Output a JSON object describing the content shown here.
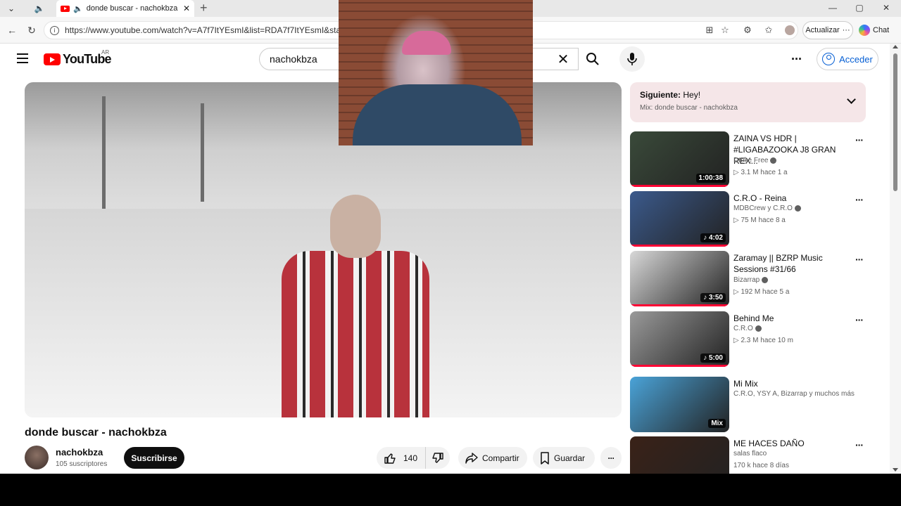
{
  "browser": {
    "tab_title": "donde buscar - nachokbza - Y",
    "url": "https://www.youtube.com/watch?v=A7f7ItYEsmI&list=RDA7f7ItYEsmI&start_",
    "update_label": "Actualizar",
    "chat_label": "Chat"
  },
  "youtube": {
    "logo_text": "YouTube",
    "country_code": "AR",
    "search_value": "nachokbza",
    "signin_label": "Acceder"
  },
  "video": {
    "title": "donde buscar - nachokbza",
    "channel": "nachokbza",
    "subscribers": "105 suscriptores",
    "subscribe_label": "Suscribirse",
    "likes": "140",
    "share_label": "Compartir",
    "save_label": "Guardar"
  },
  "up_next": {
    "label": "Siguiente:",
    "title": "Hey!",
    "playlist": "Mix: donde buscar - nachokbza"
  },
  "related": [
    {
      "title": "ZAINA VS HDR | #LIGABAZOOKA J8 GRAN REX...",
      "channel": "Dtoke Free",
      "meta": "▷ 3.1 M   hace 1 a",
      "duration": "1:00:38",
      "color": "#3a4a3a"
    },
    {
      "title": "C.R.O - Reina",
      "channel": "MDBCrew  y C.R.O",
      "meta": "▷ 75 M   hace 8 a",
      "duration": "♪ 4:02",
      "color": "#3b5a8c"
    },
    {
      "title": "Zaramay || BZRP Music Sessions #31/66",
      "channel": "Bizarrap",
      "meta": "▷ 192 M   hace 5 a",
      "duration": "♪ 3:50",
      "color": "#d8d8d8"
    },
    {
      "title": "Behind Me",
      "channel": "C.R.O",
      "meta": "▷ 2.3 M   hace 10 m",
      "duration": "♪ 5:00",
      "color": "#9a9a9a"
    },
    {
      "title": "Mi Mix",
      "channel": "C.R.O, YSY A, Bizarrap y muchos más",
      "meta": "",
      "duration": "Mix",
      "color": "#4aa3d8"
    },
    {
      "title": "ME HACES DAÑO",
      "channel": "salas flaco",
      "meta": "170 k   hace 8 días",
      "duration": "",
      "color": "#3a2218"
    }
  ]
}
